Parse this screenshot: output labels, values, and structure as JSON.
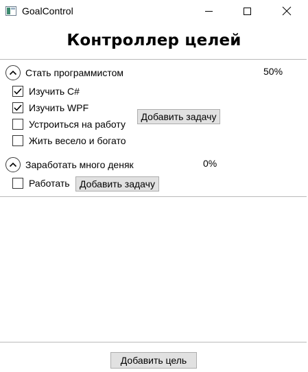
{
  "window": {
    "title": "GoalControl",
    "icon": "app-icon",
    "controls": [
      "minimize-icon",
      "maximize-icon",
      "close-icon"
    ]
  },
  "heading": "Контроллер целей",
  "goals": [
    {
      "name": "Стать программистом",
      "progress_label": "50%",
      "progress": 0.5,
      "expanded": true,
      "tasks": [
        {
          "label": "Изучить C#",
          "checked": true
        },
        {
          "label": "Изучить WPF",
          "checked": true
        },
        {
          "label": "Устроиться на работу",
          "checked": false
        },
        {
          "label": "Жить весело и богато",
          "checked": false
        }
      ],
      "add_task_label": "Добавить задачу"
    },
    {
      "name": "Заработать много деняк",
      "progress_label": "0%",
      "progress": 0,
      "expanded": true,
      "tasks": [
        {
          "label": "Работать",
          "checked": false
        }
      ],
      "add_task_label": "Добавить задачу"
    }
  ],
  "footer": {
    "add_goal_label": "Добавить цель"
  }
}
